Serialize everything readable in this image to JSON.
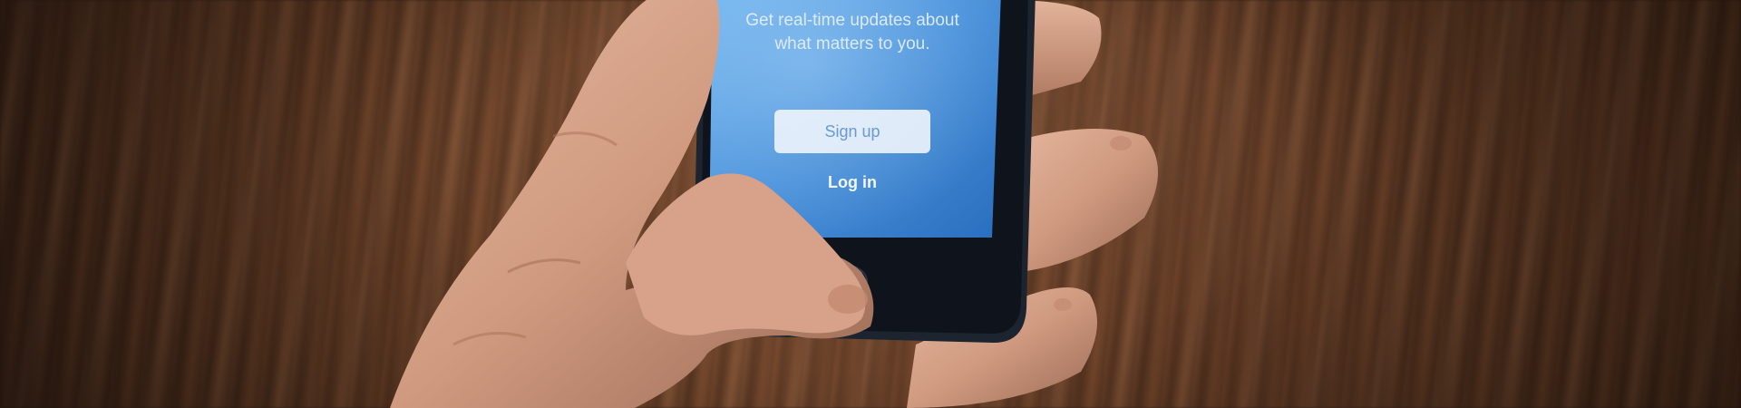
{
  "screen": {
    "tagline": "Get real-time updates about\nwhat matters to you.",
    "signup_label": "Sign up",
    "login_label": "Log in"
  },
  "colors": {
    "screen_top": "#5aa6e6",
    "screen_bottom": "#2f78c4",
    "button_text": "#6a9ad2",
    "wood": "#6b4128",
    "skin": "#d9a58c"
  }
}
